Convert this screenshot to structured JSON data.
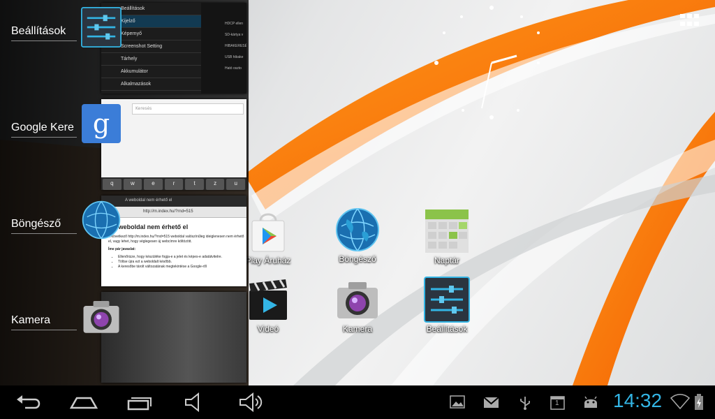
{
  "recents": [
    {
      "label": "Beállítások",
      "icon": "settings-icon"
    },
    {
      "label": "Google Kere",
      "icon": "google-search-icon"
    },
    {
      "label": "Böngésző",
      "icon": "browser-globe-icon"
    },
    {
      "label": "Kamera",
      "icon": "camera-icon"
    }
  ],
  "settings_thumb": {
    "rows": [
      "Beállítások",
      "Kijelző",
      "Képernyő",
      "Screenshot Setting",
      "Tárhely",
      "Akkumulátor",
      "Alkalmazások"
    ],
    "right": [
      "HDCP ellen",
      "SD-kártya v",
      "HIBAKERESÉS",
      "USB hibake",
      "Ható oszto"
    ]
  },
  "google_thumb": {
    "placeholder": "Keresés",
    "keys": [
      "q",
      "w",
      "e",
      "r",
      "t",
      "z",
      "u"
    ]
  },
  "browser_thumb": {
    "tab": "A weboldal nem érhető el",
    "url": "http://m.index.hu/?rnd=515",
    "heading": "A weboldal nem érhető el",
    "body": "A következő http://m.index.hu/?rnd=515 weboldal valószínűleg ideiglenesen nem érhető el, vagy lehet, hogy véglegesen új webcímre költözött.",
    "tips_title": "Íme pár javaslat:",
    "tips": [
      "Ellenőrizze, hogy készüléke fogja-e a jelet és képes-e adatátvitelre.",
      "Töltse újra ezt a weboldalt később.",
      "A keresőbe tárolt változatának megtekintése a Google-ről"
    ]
  },
  "home_apps": [
    {
      "label": "Play Áruház",
      "icon": "play-store-icon"
    },
    {
      "label": "Böngésző",
      "icon": "browser-globe-icon"
    },
    {
      "label": "Naptár",
      "icon": "calendar-icon"
    },
    {
      "label": "Videó",
      "icon": "video-icon"
    },
    {
      "label": "Kamera",
      "icon": "camera-icon"
    },
    {
      "label": "Beállítások",
      "icon": "settings-icon"
    }
  ],
  "status": {
    "time": "14:32",
    "notification_count": "1",
    "accent": "#33b5e5"
  },
  "nav": [
    "back-icon",
    "home-icon",
    "recent-apps-icon",
    "volume-down-icon",
    "volume-up-icon"
  ]
}
